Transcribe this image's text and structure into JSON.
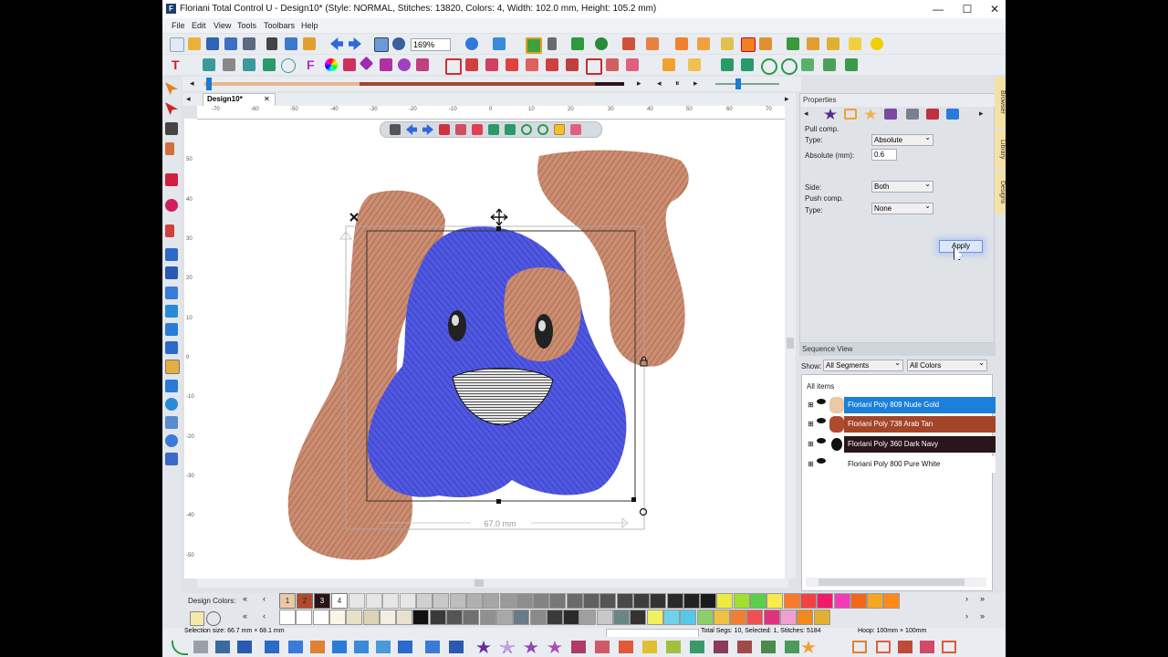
{
  "window": {
    "title": "Floriani Total Control U - Design10* (Style: NORMAL, Stitches: 13820, Colors: 4, Width: 102.0 mm, Height: 105.2 mm)",
    "controls": {
      "minimize": "—",
      "maximize": "☐",
      "close": "✕"
    }
  },
  "menu": [
    "File",
    "Edit",
    "View",
    "Tools",
    "Toolbars",
    "Help"
  ],
  "toolbar": {
    "zoom": "169%"
  },
  "document": {
    "tab": "Design10*",
    "tab_close": "✕",
    "ruler_h": [
      "-70",
      "-60",
      "-50",
      "-40",
      "-30",
      "-20",
      "-10",
      "0",
      "10",
      "20",
      "30",
      "40",
      "50",
      "60",
      "70"
    ],
    "ruler_v": [
      "50",
      "40",
      "30",
      "20",
      "10",
      "0",
      "-10",
      "-20",
      "-30",
      "-40",
      "-50"
    ],
    "selection_width_label": "67.0 mm"
  },
  "properties": {
    "title": "Properties",
    "pull_comp_label": "Pull comp.",
    "type_label": "Type:",
    "type_value": "Absolute",
    "absolute_label": "Absolute (mm):",
    "absolute_value": "0.6",
    "side_label": "Side:",
    "side_value": "Both",
    "push_comp_label": "Push comp.",
    "push_type_label": "Type:",
    "push_type_value": "None",
    "apply_label": "Apply"
  },
  "side_tabs": [
    "Browser",
    "Library",
    "Designs"
  ],
  "sequence": {
    "title": "Sequence View",
    "show_label": "Show:",
    "segments_filter": "All Segments",
    "colors_filter": "All Colors",
    "all_items": "All items",
    "items": [
      {
        "label": "Floriani Poly 809 Nude Gold",
        "bg": "#1a80d9",
        "fg": "#ffffff"
      },
      {
        "label": "Floriani Poly 738 Arab Tan",
        "bg": "#a4452a",
        "fg": "#ffffff"
      },
      {
        "label": "Floriani Poly 360 Dark Navy",
        "bg": "#2a161a",
        "fg": "#ffffff"
      },
      {
        "label": "Floriani Poly 800 Pure White",
        "bg": "#ffffff",
        "fg": "#111111"
      }
    ]
  },
  "design_colors": {
    "label": "Design Colors:",
    "chips": [
      {
        "label": "1",
        "color": "#e9c9a6",
        "fg": "#222222"
      },
      {
        "label": "2",
        "color": "#b04a2c",
        "fg": "#222222"
      },
      {
        "label": "3",
        "color": "#2a1315",
        "fg": "#ffffff"
      },
      {
        "label": "4",
        "color": "#ffffff",
        "fg": "#222222"
      }
    ]
  },
  "palette": {
    "row1": [
      "#e6e6e6",
      "#e6e6e6",
      "#dcdcdc",
      "#dcdcdc",
      "#d0d0d0",
      "#c8c8c8",
      "#bdbdbd",
      "#b0b0b0",
      "#a6a6a6",
      "#9a9a9a",
      "#8e8e8e",
      "#838383",
      "#777777",
      "#6b6b6b",
      "#606060",
      "#555555",
      "#494949",
      "#3d3d3d",
      "#333333",
      "#2a2a2a",
      "#222222",
      "#1a1a1a",
      "#ecec40",
      "#9fe030",
      "#59d04a",
      "#f9ea4d",
      "#f97a2a",
      "#f34141",
      "#f2196b",
      "#f33bba",
      "#f2661c",
      "#f5a623",
      "#ff8a1a"
    ],
    "row2": [
      "#ffffff",
      "#ffffff",
      "#ffffff",
      "#faf5e8",
      "#e8dfc8",
      "#dcd2b4",
      "#f3eee0",
      "#e8e1d0",
      "#111111",
      "#3a3a3a",
      "#555555",
      "#707070",
      "#909090",
      "#a8a8a8",
      "#6a7a86",
      "#8a8a8a",
      "#3a3a3a",
      "#2a2a2a",
      "#a0a0a0",
      "#c8c8c8",
      "#6a8686",
      "#333333",
      "#f0f060",
      "#6fd2e6",
      "#58c8e8",
      "#8acf6a",
      "#f0c040",
      "#f08030",
      "#f05050",
      "#e03080",
      "#f0a0d0",
      "#f08a1a",
      "#e0b030"
    ]
  },
  "status": {
    "selection_size": "Selection size: 66.7 mm × 68.1 mm",
    "totals": "Total Segs: 10, Selected: 1, Stitches: 5184",
    "hoop": "Hoop: 100mm × 100mm"
  }
}
